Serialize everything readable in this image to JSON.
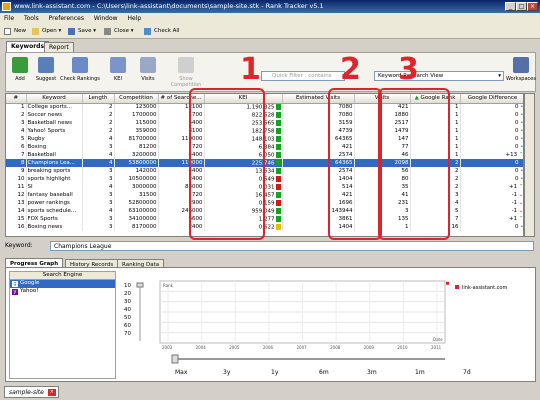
{
  "window": {
    "title": "www.link-assistant.com - C:\\Users\\link-assistant\\documents\\sample-site.stk - Rank Tracker v5.1"
  },
  "menu": [
    "File",
    "Tools",
    "Preferences",
    "Window",
    "Help"
  ],
  "toolbar": {
    "new": "New",
    "open": "Open",
    "save": "Save",
    "close": "Close",
    "check_all": "Check All"
  },
  "top_tabs": [
    "Keywords",
    "Report"
  ],
  "ribbon": {
    "add": "Add",
    "suggest": "Suggest",
    "check_rankings": "Check Rankings",
    "kei": "KEI",
    "visits": "Visits",
    "show_competition": "Show Competition",
    "quick_filter_placeholder": "Quick Filter : contains",
    "view_select": "Keyword Research View",
    "workspaces": "Workspaces"
  },
  "table": {
    "headers": [
      "#",
      "Keyword",
      "Length",
      "Competition",
      "# of Searche...",
      "KEI",
      "Estimated Visits",
      "Visits",
      "Google Rank",
      "Google Difference"
    ],
    "rows": [
      [
        "1",
        "College sports...",
        "2",
        "123000",
        "12100",
        "1,190,325",
        "green",
        "7080",
        "421",
        "1",
        "0",
        "dot"
      ],
      [
        "2",
        "Soccer news",
        "2",
        "1700000",
        "1700",
        "822,528",
        "green",
        "7080",
        "1880",
        "1",
        "0",
        "dot"
      ],
      [
        "3",
        "Basketball news",
        "2",
        "115000",
        "5400",
        "253,565",
        "green",
        "3159",
        "2517",
        "1",
        "0",
        "dot"
      ],
      [
        "4",
        "Yahoo! Sports",
        "2",
        "359000",
        "8100",
        "182,758",
        "green",
        "4739",
        "1479",
        "1",
        "0",
        "dot"
      ],
      [
        "5",
        "Rugby",
        "4",
        "81700000",
        "110000",
        "148,103",
        "green",
        "64365",
        "147",
        "1",
        "0",
        "dot"
      ],
      [
        "6",
        "Boxing",
        "3",
        "81200",
        "720",
        "6,384",
        "green",
        "421",
        "77",
        "1",
        "0",
        "dot"
      ],
      [
        "7",
        "Basketball",
        "4",
        "3200000",
        "4400",
        "6,050",
        "green",
        "2574",
        "46",
        "1",
        "+13",
        "up"
      ],
      [
        "8",
        "Champions Lea...",
        "4",
        "53800000",
        "110000",
        "225,746",
        "green",
        "64365",
        "2098",
        "2",
        "0",
        "dot"
      ],
      [
        "9",
        "breaking sports",
        "3",
        "142000",
        "4400",
        "13,634",
        "green",
        "2574",
        "56",
        "2",
        "0",
        "dot"
      ],
      [
        "10",
        "sports highlight",
        "3",
        "10500000",
        "2400",
        "0,549",
        "red",
        "1404",
        "80",
        "2",
        "0",
        "dot"
      ],
      [
        "11",
        "SI",
        "4",
        "3000000",
        "88000",
        "0,031",
        "red",
        "514",
        "35",
        "2",
        "+1",
        "up"
      ],
      [
        "12",
        "fantasy baseball",
        "3",
        "31500",
        "720",
        "16,457",
        "green",
        "421",
        "41",
        "3",
        "-1",
        "down"
      ],
      [
        "13",
        "power rankings",
        "3",
        "52800000",
        "2900",
        "0,159",
        "red",
        "1696",
        "231",
        "4",
        "-1",
        "down"
      ],
      [
        "14",
        "sports schedule...",
        "4",
        "63100000",
        "246000",
        "959,049",
        "green",
        "143944",
        "3",
        "5",
        "-1",
        "down"
      ],
      [
        "15",
        "FOX Sports",
        "3",
        "34100000",
        "6600",
        "1,277",
        "green",
        "3861",
        "135",
        "7",
        "+1",
        "up"
      ],
      [
        "16",
        "Boxing news",
        "3",
        "8170000",
        "2400",
        "0,622",
        "yellow",
        "1404",
        "1",
        "16",
        "0",
        "dot"
      ]
    ],
    "selected_row": 7
  },
  "annotations": {
    "one": "1",
    "two": "2",
    "three": "3"
  },
  "keyword": {
    "label": "Keyword:",
    "value": "Champions League"
  },
  "bottom_tabs": [
    "Progress Graph",
    "History Records",
    "Ranking Data"
  ],
  "search_engines": {
    "header": "Search Engine",
    "items": [
      "Google",
      "Yahoo!"
    ]
  },
  "chart_data": {
    "type": "line",
    "y_ticks": [
      "10",
      "20",
      "30",
      "40",
      "50",
      "60",
      "70"
    ],
    "x_ticks": [
      "2003",
      "2004",
      "2005",
      "2006",
      "2007",
      "2008",
      "2009",
      "2010",
      "2011"
    ],
    "ylabel": "Rank",
    "xlabel": "Date",
    "legend": "link-assistant.com",
    "series": [
      {
        "name": "link-assistant.com",
        "values": [
          2
        ]
      }
    ],
    "range_buttons": [
      "Max",
      "3y",
      "1y",
      "6m",
      "3m",
      "1m",
      "7d"
    ]
  },
  "bottom_tab": "sample-site",
  "colors": {
    "green": "#1a9e2a",
    "red": "#c81c1c",
    "yellow": "#e0c000",
    "annot": "#d9252b",
    "select": "#316ac5"
  }
}
